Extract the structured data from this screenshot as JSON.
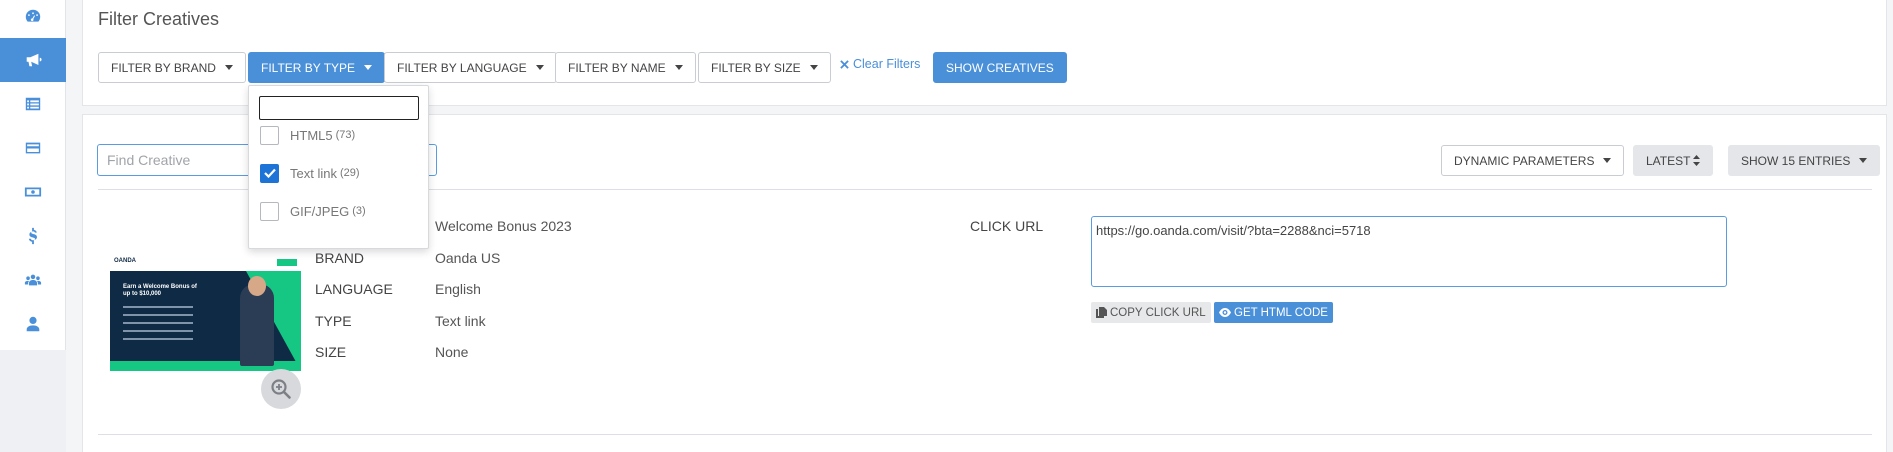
{
  "sidebar": {
    "items": [
      {
        "icon": "dashboard-icon"
      },
      {
        "icon": "megaphone-icon",
        "active": true
      },
      {
        "icon": "list-icon"
      },
      {
        "icon": "credit-card-icon"
      },
      {
        "icon": "money-bill-icon"
      },
      {
        "icon": "dollar-icon"
      },
      {
        "icon": "users-icon"
      },
      {
        "icon": "user-icon"
      }
    ]
  },
  "filters": {
    "title": "Filter Creatives",
    "brand_label": "Filter by brand",
    "type_label": "Filter by type",
    "language_label": "Filter by language",
    "name_label": "Filter by name",
    "size_label": "Filter by size",
    "clear_label": "Clear Filters",
    "show_label": "Show Creatives"
  },
  "type_dropdown": {
    "search_value": "",
    "options": [
      {
        "label": "HTML5",
        "count": "(73)",
        "checked": false
      },
      {
        "label": "Text link",
        "count": "(29)",
        "checked": true
      },
      {
        "label": "GIF/JPEG",
        "count": "(3)",
        "checked": false
      }
    ]
  },
  "toolbar": {
    "search_placeholder": "Find Creative",
    "dynamic_label": "Dynamic parameters",
    "latest_label": "Latest",
    "entries_label": "Show 15 entries"
  },
  "creative": {
    "name_value": "Welcome Bonus 2023",
    "brand_label": "Brand",
    "brand_value": "Oanda US",
    "language_label": "Language",
    "language_value": "English",
    "type_label": "Type",
    "type_value": "Text link",
    "size_label": "Size",
    "size_value": "None",
    "click_url_label": "Click URL",
    "click_url_value": "https://go.oanda.com/visit/?bta=2288&nci=5718",
    "copy_label": "Copy click URL",
    "html_label": "Get HTML code",
    "thumbnail": {
      "logo": "OANDA",
      "headline": "Earn a Welcome Bonus of up to $10,000"
    }
  },
  "colors": {
    "accent": "#4a90d9",
    "checkbox": "#1e74d6",
    "thumb_bg": "#0f2a44",
    "thumb_green": "#16c784"
  }
}
